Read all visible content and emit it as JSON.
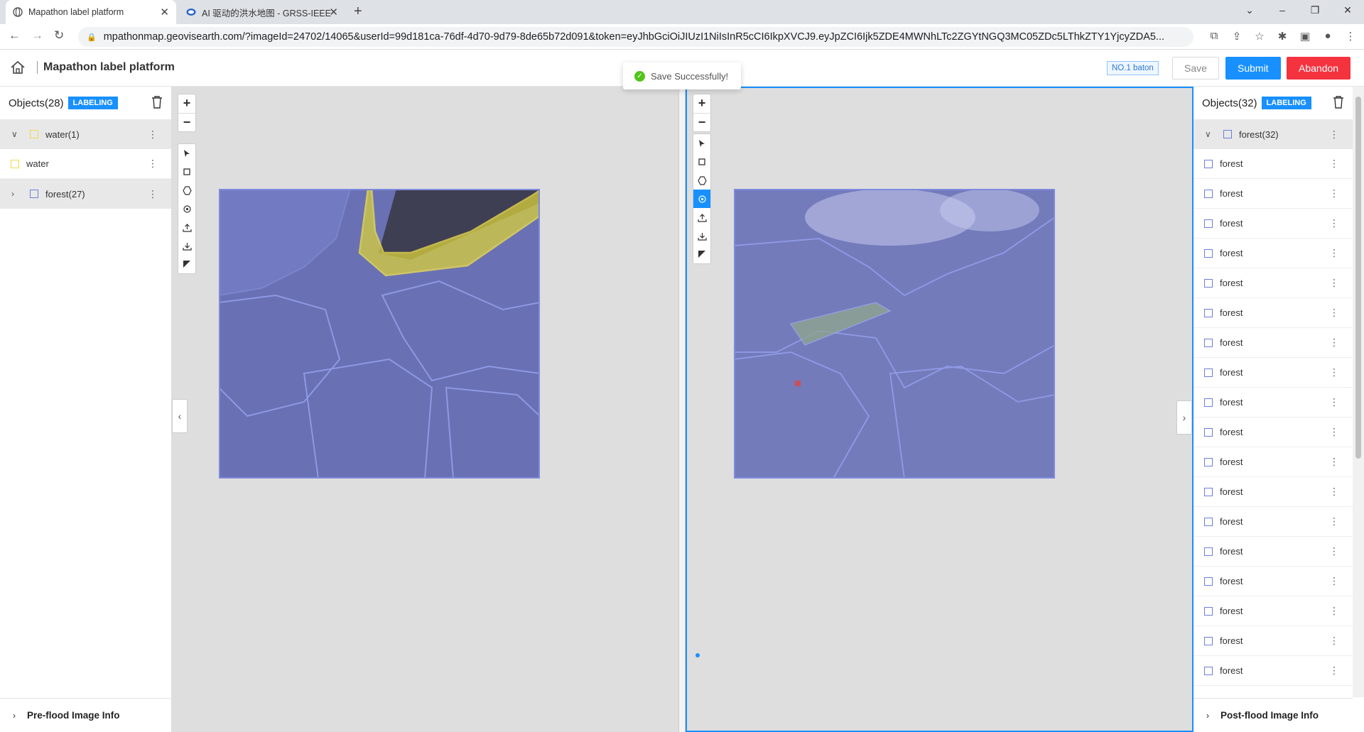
{
  "browser": {
    "tabs": [
      {
        "title": "Mapathon label platform",
        "active": true
      },
      {
        "title": "AI 驱动的洪水地图 - GRSS-IEEE",
        "active": false
      }
    ],
    "url": "mpathonmap.geovisearth.com/?imageId=24702/14065&userId=99d181ca-76df-4d70-9d79-8de65b72d091&token=eyJhbGciOiJIUzI1NiIsInR5cCI6IkpXVCJ9.eyJpZCI6Ijk5ZDE4MWNhLTc2ZGYtNGQ3MC05ZDc5LThkZTY1YjcyZDA5..."
  },
  "header": {
    "title": "Mapathon label platform",
    "toast": "Save Successfully!",
    "baton_badge": "NO.1 baton",
    "save_label": "Save",
    "submit_label": "Submit",
    "abandon_label": "Abandon"
  },
  "left_panel": {
    "title": "Objects(28)",
    "status_tag": "LABELING",
    "groups": [
      {
        "label": "water(1)",
        "color": "#f2d94e",
        "expanded": true,
        "items": [
          "water"
        ]
      },
      {
        "label": "forest(27)",
        "color": "#6c7fd8",
        "expanded": false,
        "items": []
      }
    ],
    "footer": "Pre-flood Image Info"
  },
  "right_panel": {
    "title": "Objects(32)",
    "status_tag": "LABELING",
    "group": {
      "label": "forest(32)",
      "color": "#6c7fd8",
      "expanded": true
    },
    "items": [
      "forest",
      "forest",
      "forest",
      "forest",
      "forest",
      "forest",
      "forest",
      "forest",
      "forest",
      "forest",
      "forest",
      "forest",
      "forest",
      "forest",
      "forest",
      "forest",
      "forest",
      "forest"
    ],
    "footer": "Post-flood Image Info"
  },
  "map_tools": [
    "select-icon",
    "rectangle-icon",
    "polygon-icon",
    "target-icon",
    "upload-icon",
    "download-icon",
    "contrast-icon"
  ],
  "colors": {
    "accent": "#1890ff",
    "danger": "#f5333f",
    "forest": "#6c7fd8",
    "water": "#f2d94e"
  }
}
